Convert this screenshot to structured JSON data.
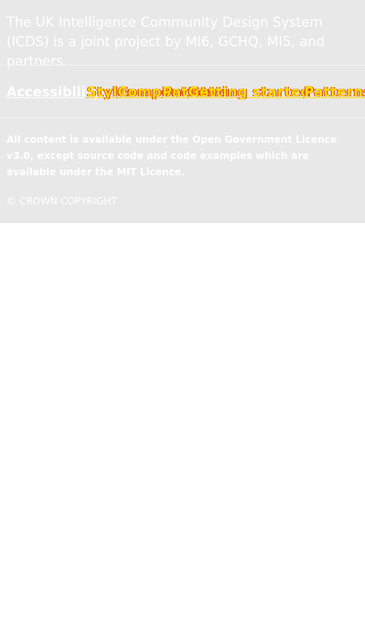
{
  "footer": {
    "description": "The UK Intelligence Community Design System (ICDS) is a joint project by MI6, GCHQ, MI5, and partners.",
    "nav": [
      {
        "label": "Accessibility"
      },
      {
        "label": "Styles"
      },
      {
        "label": "Components"
      },
      {
        "label": "Patterns"
      },
      {
        "label": "Getting started"
      },
      {
        "label": "Patterns"
      }
    ],
    "licence": "All content is available under the Open Government Licence v3.0, except source code and code examples which are available under the MIT Licence.",
    "copyright": "© CROWN COPYRIGHT"
  }
}
